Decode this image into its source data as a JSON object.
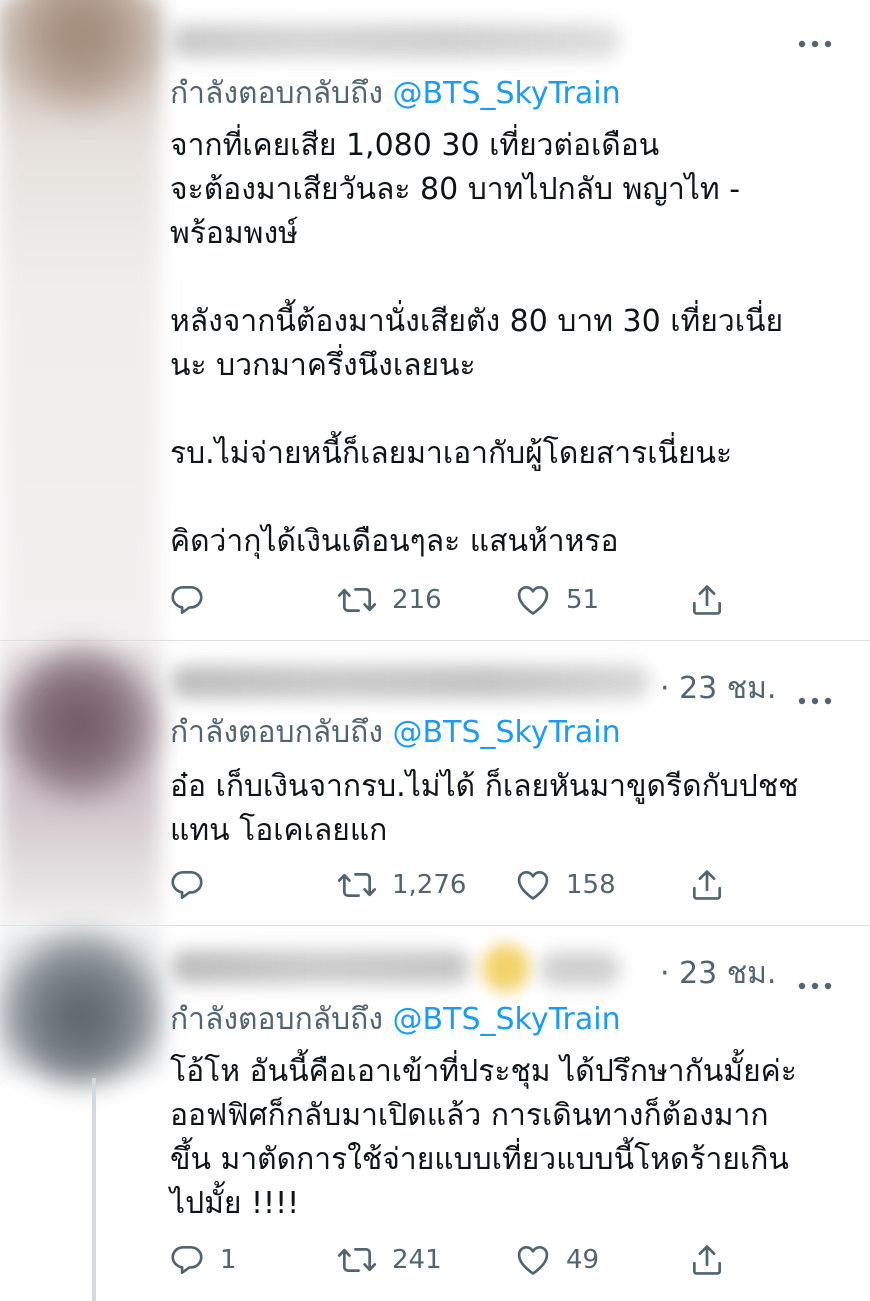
{
  "tweets": [
    {
      "time": "",
      "reply_prefix": "กำลังตอบกลับถึง",
      "reply_handle": "@BTS_SkyTrain",
      "lines": [
        "จากที่เคยเสีย 1,080 30 เที่ยวต่อเดือน",
        "จะต้องมาเสียวันละ 80 บาทไปกลับ พญาไท -",
        "พร้อมพงษ์",
        "",
        "หลังจากนี้ต้องมานั่งเสียตัง 80 บาท 30 เที่ยวเนี่ย",
        "นะ บวกมาครึ่งนึงเลยนะ",
        "",
        "รบ.ไม่จ่ายหนี้ก็เลยมาเอากับผู้โดยสารเนี่ยนะ",
        "",
        "คิดว่ากุได้เงินเดือนๆละ แสนห้าหรอ"
      ],
      "replies": "",
      "retweets": "216",
      "likes": "51"
    },
    {
      "time": "· 23 ชม.",
      "reply_prefix": "กำลังตอบกลับถึง",
      "reply_handle": "@BTS_SkyTrain",
      "lines": [
        "อ๋อ เก็บเงินจากรบ.ไม่ได้ ก็เลยหันมาขูดรีดกับปชช",
        "แทน โอเคเลยแก"
      ],
      "replies": "",
      "retweets": "1,276",
      "likes": "158"
    },
    {
      "time": "· 23 ชม.",
      "reply_prefix": "กำลังตอบกลับถึง",
      "reply_handle": "@BTS_SkyTrain",
      "lines": [
        "โอ้โห อันนี้คือเอาเข้าที่ประชุม ได้ปรึกษากันมั้ยค่ะ",
        "ออฟฟิศก็กลับมาเปิดแล้ว การเดินทางก็ต้องมาก",
        "ขึ้น มาตัดการใช้จ่ายแบบเที่ยวแบบนี้โหดร้ายเกิน",
        "ไปมั้ย !!!!"
      ],
      "replies": "1",
      "retweets": "241",
      "likes": "49"
    }
  ],
  "icons": {
    "more": "more-horizontal-icon",
    "reply": "reply-bubble-icon",
    "retweet": "retweet-arrows-icon",
    "like": "heart-icon",
    "share": "share-upload-icon"
  },
  "colors": {
    "text": "#0f1419",
    "secondary": "#536471",
    "link": "#1d9bf0",
    "divider": "#d9dfe3"
  }
}
